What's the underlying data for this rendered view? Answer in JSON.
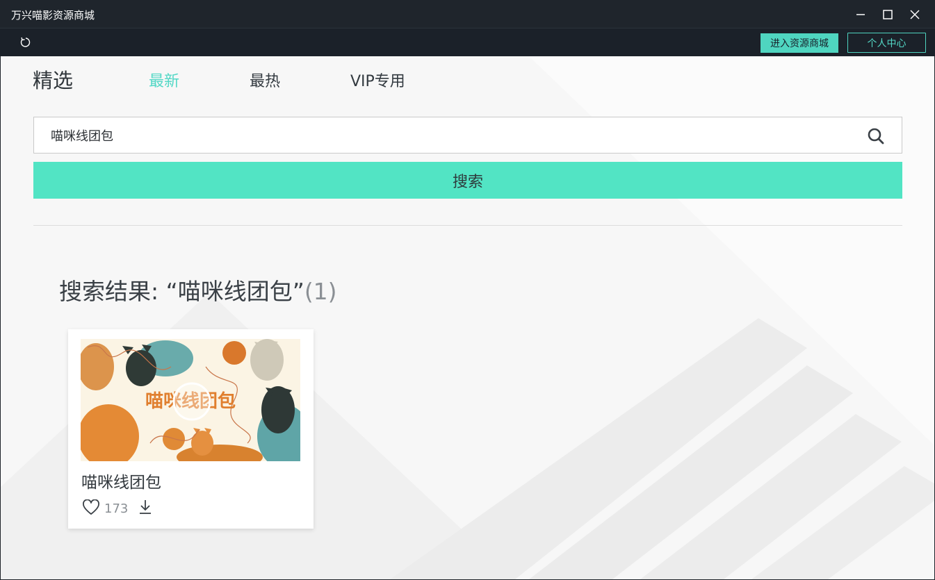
{
  "window": {
    "title": "万兴喵影资源商城"
  },
  "toolbar": {
    "store_button": "进入资源商城",
    "user_button": "个人中心",
    "accent_color": "#4fd5c0"
  },
  "tabs": [
    {
      "label": "精选",
      "active": false
    },
    {
      "label": "最新",
      "active": true
    },
    {
      "label": "最热",
      "active": false
    },
    {
      "label": "VIP专用",
      "active": false
    }
  ],
  "search": {
    "value": "喵咪线团包",
    "button_label": "搜索",
    "button_color": "#52e4c4"
  },
  "results": {
    "label": "搜索结果: “喵咪线团包”",
    "count": "(1)",
    "items": [
      {
        "title": "喵咪线团包",
        "likes": "173",
        "thumbnail_text": "喵咪线团包"
      }
    ]
  }
}
